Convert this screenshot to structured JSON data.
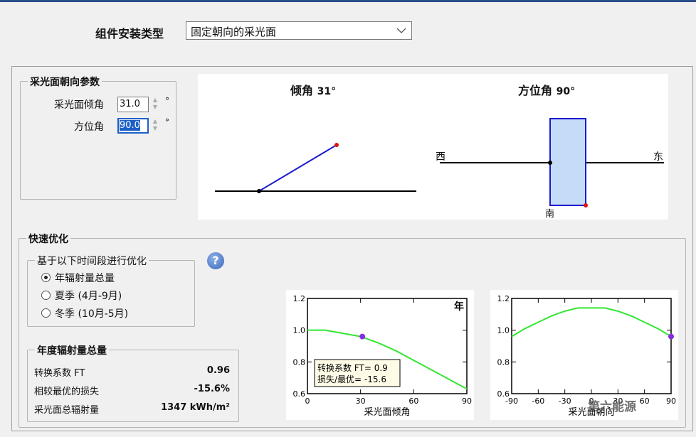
{
  "header": {
    "install_type_label": "组件安装类型",
    "install_type_value": "固定朝向的采光面"
  },
  "orientation": {
    "legend": "采光面朝向参数",
    "tilt_label": "采光面倾角",
    "tilt_value": "31.0",
    "azimuth_label": "方位角",
    "azimuth_value": "90.0",
    "unit": "°"
  },
  "diagrams": {
    "tilt_title": "倾角",
    "tilt_value": "31°",
    "azimuth_title": "方位角",
    "azimuth_value": "90°",
    "west": "西",
    "east": "东",
    "south": "南"
  },
  "optimize": {
    "legend": "快速优化",
    "period_legend": "基于以下时间段进行优化",
    "options": [
      {
        "label": "年辐射量总量",
        "selected": true
      },
      {
        "label": "夏季 (4月-9月)",
        "selected": false
      },
      {
        "label": "冬季 (10月-5月)",
        "selected": false
      }
    ],
    "help_icon": "?"
  },
  "annual": {
    "legend": "年度辐射量总量",
    "rows": [
      {
        "label": "转换系数 FT",
        "value": "0.96"
      },
      {
        "label": "相较最优的损失",
        "value": "-15.6%"
      },
      {
        "label": "采光面总辐射量",
        "value": "1347 kWh/m²"
      }
    ]
  },
  "chart_data": [
    {
      "type": "line",
      "title": "年",
      "xlabel": "采光面倾角",
      "ylabel": "",
      "xlim": [
        0,
        90
      ],
      "ylim": [
        0.6,
        1.2
      ],
      "xticks": [
        "0",
        "30",
        "60",
        "90"
      ],
      "yticks": [
        "0.6",
        "0.8",
        "1.0",
        "1.2"
      ],
      "x": [
        0,
        10,
        20,
        30,
        40,
        50,
        60,
        70,
        80,
        90
      ],
      "y": [
        1.0,
        1.0,
        0.98,
        0.96,
        0.92,
        0.87,
        0.81,
        0.75,
        0.69,
        0.63
      ],
      "marker": {
        "x": 31,
        "y": 0.96
      },
      "annotation": [
        "转换系数 FT= 0.9",
        "损失/最优= -15.6"
      ],
      "line_color": "#33e633",
      "marker_color": "#8a2be2"
    },
    {
      "type": "line",
      "title": "",
      "xlabel": "采光面朝向",
      "ylabel": "",
      "xlim": [
        -90,
        90
      ],
      "ylim": [
        0.6,
        1.2
      ],
      "xticks": [
        "-90",
        "-60",
        "-30",
        "0",
        "30",
        "60",
        "90"
      ],
      "yticks": [
        "0.6",
        "0.8",
        "1.0",
        "1.2"
      ],
      "x": [
        -90,
        -75,
        -60,
        -45,
        -30,
        -15,
        0,
        15,
        30,
        45,
        60,
        75,
        90
      ],
      "y": [
        0.96,
        1.01,
        1.05,
        1.09,
        1.12,
        1.14,
        1.14,
        1.14,
        1.12,
        1.09,
        1.05,
        1.01,
        0.96
      ],
      "marker": {
        "x": 90,
        "y": 0.96
      },
      "line_color": "#33e633",
      "marker_color": "#8a2be2"
    }
  ],
  "watermark": "第六能源"
}
